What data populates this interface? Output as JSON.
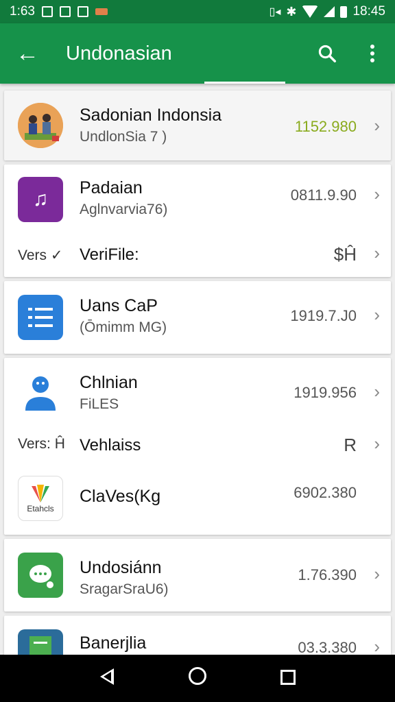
{
  "status_bar": {
    "left_time": "1:63",
    "right_time": "18:45"
  },
  "app_bar": {
    "back_icon": "arrow-left-icon",
    "title": "Undonasian",
    "search_icon": "search-icon",
    "menu_icon": "more-vert-icon"
  },
  "items": [
    {
      "name": "Sadonian Indonsia",
      "subtitle": "UndlonSia 7 )",
      "size": "1152.980",
      "size_color": "#8aab1e",
      "icon": "people-illustration-icon"
    },
    {
      "name": "Padaian",
      "subtitle": "Aglnvarvia76)",
      "size": "0811.9.90",
      "icon": "music-note-icon",
      "vers_label": "Vers ✓",
      "vers_name": "VeriFile:",
      "vers_sym": "$Ĥ"
    },
    {
      "name": "Uans CaP",
      "subtitle": "(Ōmimm MG)",
      "size": "1919.7.J0",
      "icon": "list-document-icon"
    },
    {
      "name": "Chlnian",
      "subtitle": "FiLES",
      "size": "1919.956",
      "icon": "person-icon",
      "vers_label": "Vers: Ĥ",
      "vers_name": "Vehlaiss",
      "vers_sym": "R"
    },
    {
      "name": "ClaVes(Kg",
      "subtitle": "",
      "size": "6902.380",
      "icon": "multicolor-logo-icon",
      "icon_label": "Etahcls"
    },
    {
      "name": "Undosiánn",
      "subtitle": "SragarSraU6)",
      "size": "1.76.390",
      "icon": "chat-bubble-icon"
    },
    {
      "name": "Banerjlia",
      "subtitle": "",
      "size": "03.3.380",
      "icon": "document-icon"
    }
  ],
  "nav_bar": {
    "back": "nav-back-icon",
    "home": "nav-home-icon",
    "recents": "nav-recents-icon"
  }
}
